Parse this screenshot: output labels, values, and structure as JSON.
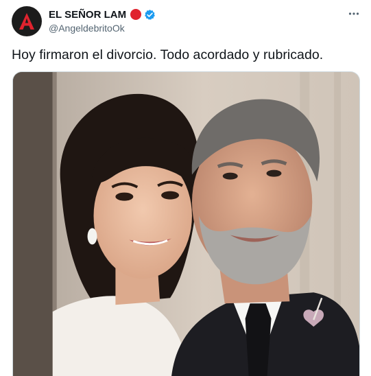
{
  "tweet": {
    "author": {
      "display_name": "EL SEÑOR LAM",
      "handle": "@AngeldebritoOk",
      "avatar_letter": "A",
      "avatar_color": "#1c1c1c",
      "avatar_letter_color": "#e0232e",
      "verified": true,
      "badge_color": "#e0232e",
      "verified_color": "#1d9bf0"
    },
    "text": "Hoy firmaron el divorcio. Todo acordado y rubricado.",
    "more_icon": "more-horizontal-icon",
    "media": {
      "kind": "photo",
      "subject": "couple-portrait"
    }
  }
}
